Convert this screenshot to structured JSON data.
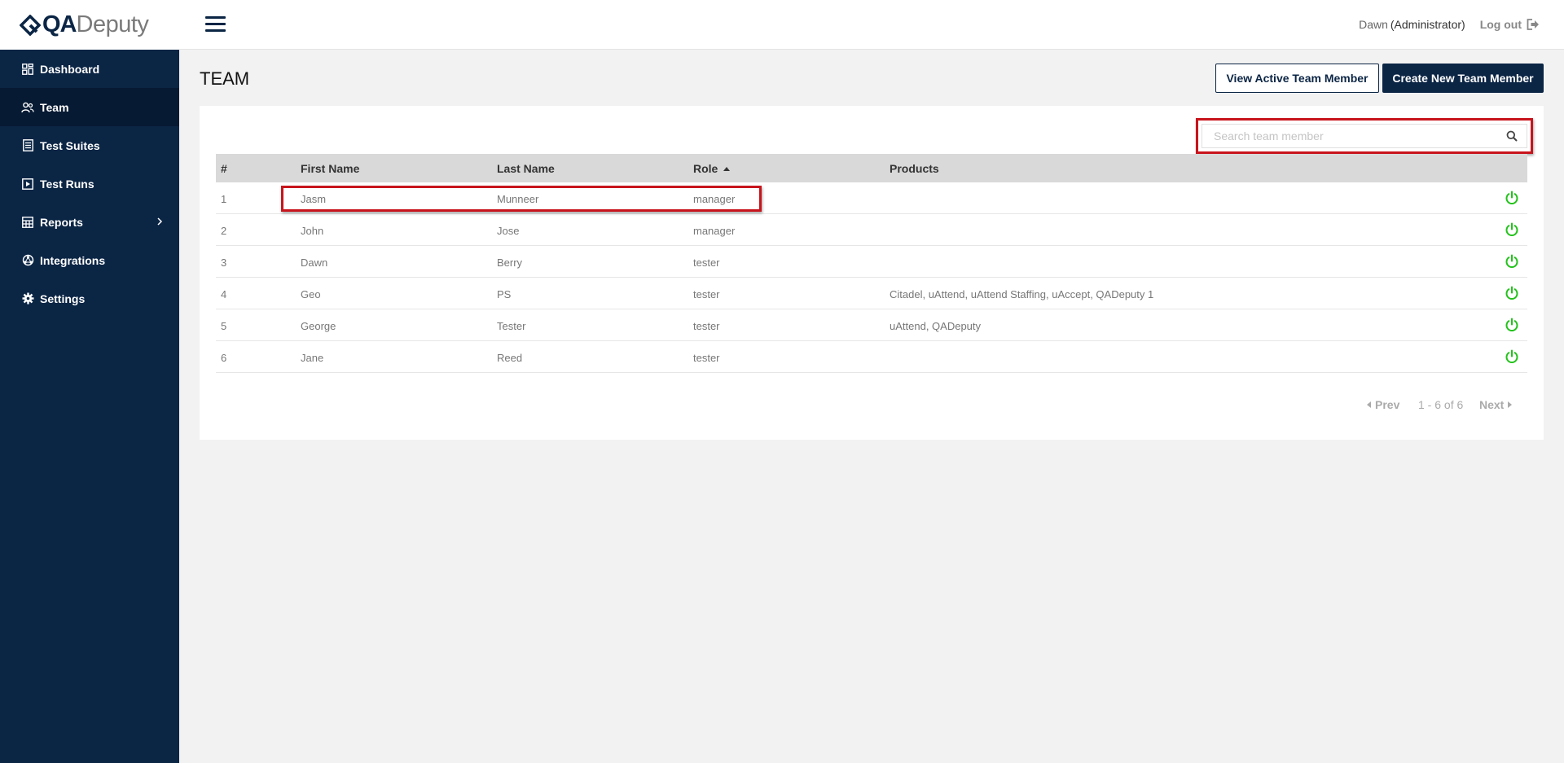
{
  "app": {
    "logo_bold": "QA",
    "logo_light": "Deputy"
  },
  "sidebar": {
    "items": [
      {
        "label": "Dashboard",
        "icon": "dashboard-icon"
      },
      {
        "label": "Team",
        "icon": "team-icon",
        "active": true
      },
      {
        "label": "Test Suites",
        "icon": "test-suites-icon"
      },
      {
        "label": "Test Runs",
        "icon": "test-runs-icon"
      },
      {
        "label": "Reports",
        "icon": "reports-icon",
        "has_submenu": true
      },
      {
        "label": "Integrations",
        "icon": "integrations-icon"
      },
      {
        "label": "Settings",
        "icon": "gear-icon"
      }
    ]
  },
  "header": {
    "user_name": "Dawn",
    "user_role": "(Administrator)",
    "logout_label": "Log out"
  },
  "page": {
    "title": "TEAM",
    "view_active_label": "View Active Team Member",
    "create_new_label": "Create New Team Member"
  },
  "search": {
    "placeholder": "Search team member",
    "value": ""
  },
  "table": {
    "columns": [
      "#",
      "First Name",
      "Last Name",
      "Role",
      "Products"
    ],
    "sorted_column": "Role",
    "sort_direction": "ascending",
    "rows": [
      {
        "num": "1",
        "first": "Jasm",
        "last": "Munneer",
        "role": "manager",
        "products": ""
      },
      {
        "num": "2",
        "first": "John",
        "last": "Jose",
        "role": "manager",
        "products": ""
      },
      {
        "num": "3",
        "first": "Dawn",
        "last": "Berry",
        "role": "tester",
        "products": ""
      },
      {
        "num": "4",
        "first": "Geo",
        "last": "PS",
        "role": "tester",
        "products": "Citadel, uAttend, uAttend Staffing, uAccept, QADeputy 1"
      },
      {
        "num": "5",
        "first": "George",
        "last": "Tester",
        "role": "tester",
        "products": "uAttend, QADeputy"
      },
      {
        "num": "6",
        "first": "Jane",
        "last": "Reed",
        "role": "tester",
        "products": ""
      }
    ]
  },
  "pagination": {
    "prev_label": "Prev",
    "range": "1 - 6 of 6",
    "next_label": "Next"
  },
  "colors": {
    "brand_navy": "#0b2545",
    "active_green": "#22c21a",
    "highlight_red": "#c8141c"
  }
}
